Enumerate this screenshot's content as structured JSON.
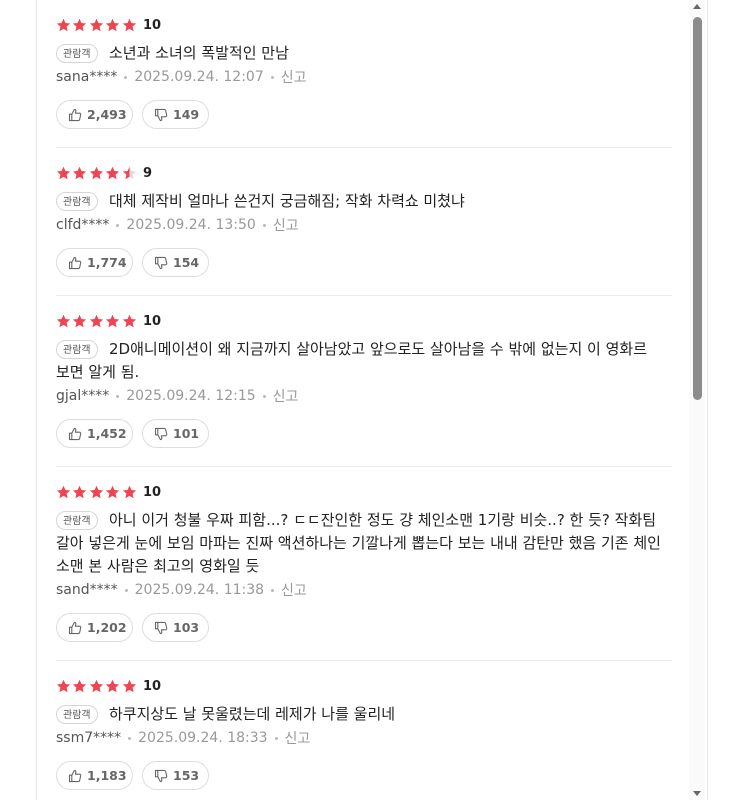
{
  "badge_label": "관람객",
  "report_label": "신고",
  "star_color": "#f04452",
  "star_empty_color": "#dcdcdc",
  "icons": {
    "like": "thumbs-up-icon",
    "dislike": "thumbs-down-icon",
    "star": "star-icon"
  },
  "reviews": [
    {
      "stars": 5,
      "score": "10",
      "text": "소년과 소녀의 폭발적인 만남",
      "user": "sana****",
      "date": "2025.09.24. 12:07",
      "likes": "2,493",
      "dislikes": "149"
    },
    {
      "stars": 4.5,
      "score": "9",
      "text": "대체 제작비 얼마나 쓴건지 궁금해짐; 작화 차력쇼 미쳤냐",
      "user": "clfd****",
      "date": "2025.09.24. 13:50",
      "likes": "1,774",
      "dislikes": "154"
    },
    {
      "stars": 5,
      "score": "10",
      "text": "2D애니메이션이 왜 지금까지 살아남았고 앞으로도 살아남을 수 밖에 없는지 이 영화르 보면 알게 됨.",
      "user": "gjal****",
      "date": "2025.09.24. 12:15",
      "likes": "1,452",
      "dislikes": "101"
    },
    {
      "stars": 5,
      "score": "10",
      "text": "아니 이거 청불 우짜 피함...? ㄷㄷ잔인한 정도 걍 체인소맨 1기랑 비슷..? 한 듯? 작화팀 갈아 넣은게 눈에 보임 마파는 진짜 액션하나는 기깔나게 뽑는다 보는 내내 감탄만 했음 기존 체인 소맨 본 사람은 최고의 영화일 듯",
      "user": "sand****",
      "date": "2025.09.24. 11:38",
      "likes": "1,202",
      "dislikes": "103"
    },
    {
      "stars": 5,
      "score": "10",
      "text": "하쿠지상도 날 못울렸는데 레제가 나를 울리네",
      "user": "ssm7****",
      "date": "2025.09.24. 18:33",
      "likes": "1,183",
      "dislikes": "153"
    }
  ]
}
